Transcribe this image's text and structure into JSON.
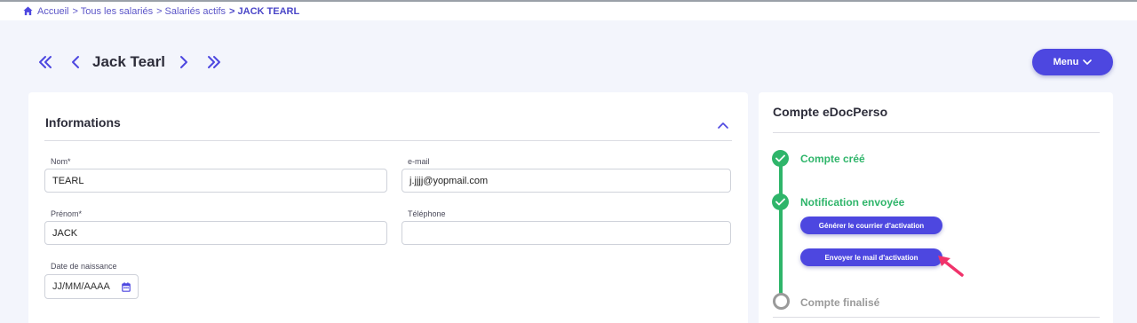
{
  "breadcrumb": {
    "items": [
      "Accueil",
      "> Tous les salariés",
      "> Salariés actifs",
      "> JACK TEARL"
    ]
  },
  "header": {
    "employee_name": "Jack Tearl",
    "menu_label": "Menu"
  },
  "informations": {
    "title": "Informations",
    "fields": {
      "nom": {
        "label": "Nom*",
        "value": "TEARL"
      },
      "email": {
        "label": "e-mail",
        "value": "j.jjjj@yopmail.com"
      },
      "prenom": {
        "label": "Prénom*",
        "value": "JACK"
      },
      "telephone": {
        "label": "Téléphone",
        "value": ""
      },
      "date_naissance": {
        "label": "Date de naissance",
        "placeholder": "JJ/MM/AAAA"
      }
    }
  },
  "compte": {
    "title": "Compte eDocPerso",
    "steps": [
      {
        "label": "Compte créé",
        "status": "done"
      },
      {
        "label": "Notification envoyée",
        "status": "done"
      },
      {
        "label": "Compte finalisé",
        "status": "pending"
      }
    ],
    "buttons": {
      "generer": "Générer le courrier d'activation",
      "envoyer": "Envoyer le mail d'activation"
    }
  },
  "colors": {
    "accent": "#4d47e0",
    "success": "#2fb56a",
    "pending": "#9a9a9a",
    "cursor": "#f0336b"
  },
  "icons": [
    "home-icon",
    "double-chevron-left-icon",
    "chevron-left-icon",
    "chevron-right-icon",
    "double-chevron-right-icon",
    "chevron-down-icon",
    "chevron-up-icon",
    "calendar-icon",
    "check-icon",
    "cursor-arrow-icon"
  ]
}
